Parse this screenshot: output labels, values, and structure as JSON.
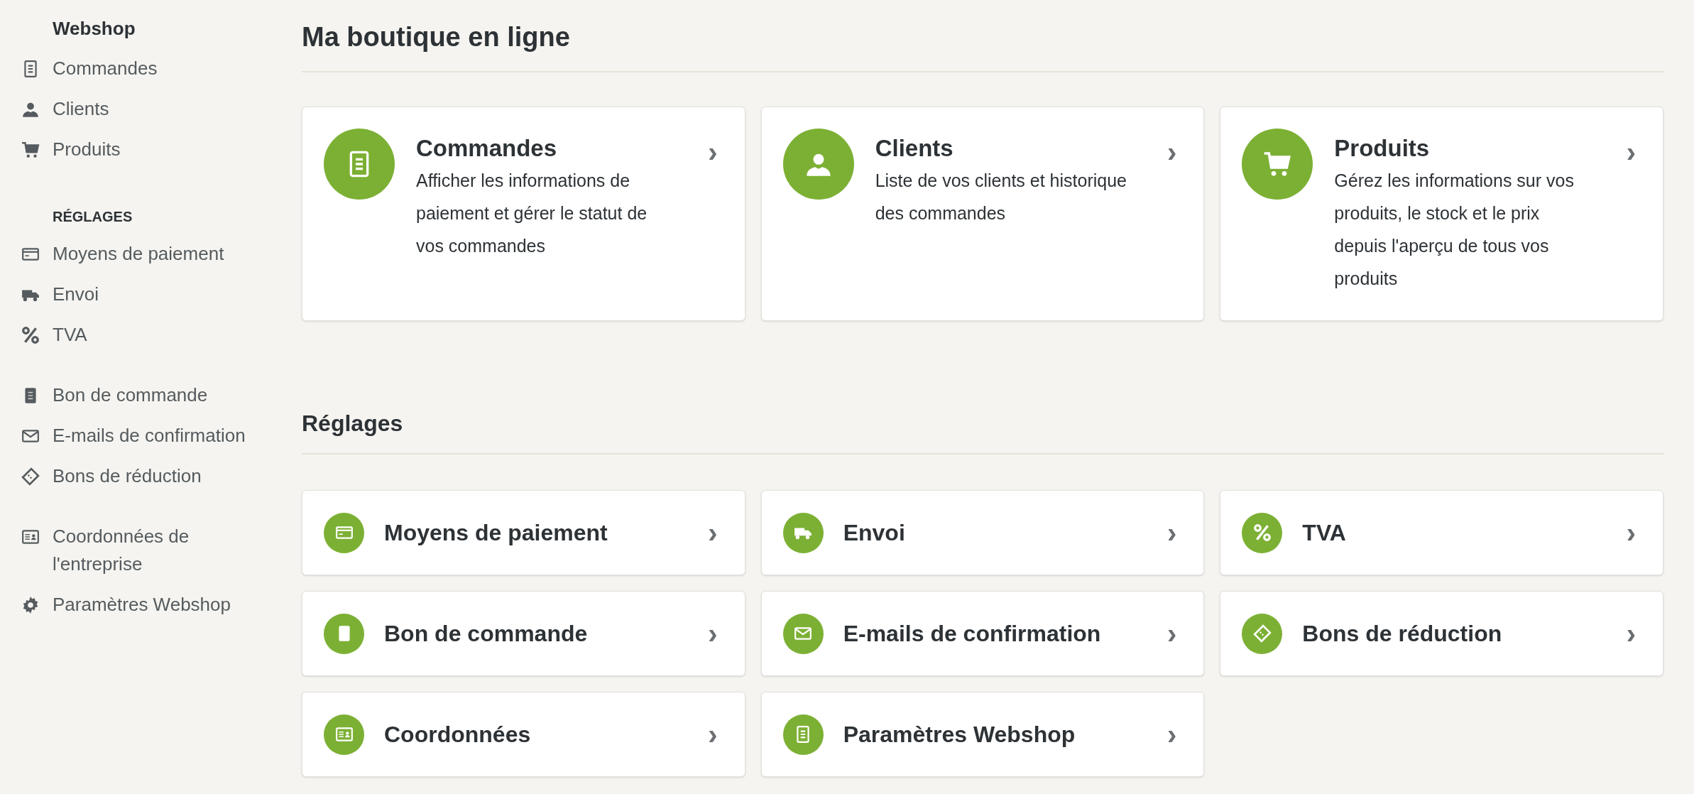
{
  "sidebar": {
    "title": "Webshop",
    "groups": [
      {
        "items": [
          {
            "label": "Commandes"
          },
          {
            "label": "Clients"
          },
          {
            "label": "Produits"
          }
        ]
      },
      {
        "heading": "RÉGLAGES",
        "items": [
          {
            "label": "Moyens de paiement"
          },
          {
            "label": "Envoi"
          },
          {
            "label": "TVA"
          }
        ]
      },
      {
        "items": [
          {
            "label": "Bon de commande"
          },
          {
            "label": "E-mails de confirmation"
          },
          {
            "label": "Bons de réduction"
          }
        ]
      },
      {
        "items": [
          {
            "label": "Coordonnées de l'entreprise"
          },
          {
            "label": "Paramètres Webshop"
          }
        ]
      }
    ]
  },
  "page_title": "Ma boutique en ligne",
  "main_cards": [
    {
      "title": "Commandes",
      "description": "Afficher les informations de paiement et gérer le statut de vos commandes",
      "chevron": "›"
    },
    {
      "title": "Clients",
      "description": "Liste de vos clients et historique des commandes",
      "chevron": "›"
    },
    {
      "title": "Produits",
      "description": "Gérez les informations sur vos produits, le stock et le prix depuis l'aperçu de tous vos produits",
      "chevron": "›"
    }
  ],
  "settings": {
    "title": "Réglages",
    "cards": [
      {
        "title": "Moyens de paiement",
        "chevron": "›"
      },
      {
        "title": "Envoi",
        "chevron": "›"
      },
      {
        "title": "TVA",
        "chevron": "›"
      },
      {
        "title": "Bon de commande",
        "chevron": "›"
      },
      {
        "title": "E-mails de confirmation",
        "chevron": "›"
      },
      {
        "title": "Bons de réduction",
        "chevron": "›"
      },
      {
        "title": "Coordonnées",
        "chevron": "›"
      },
      {
        "title": "Paramètres Webshop",
        "chevron": "›"
      }
    ]
  }
}
